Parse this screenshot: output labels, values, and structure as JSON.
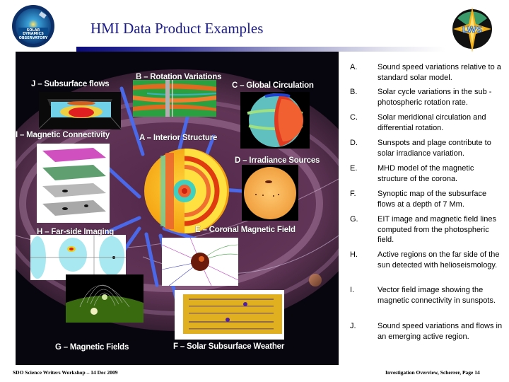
{
  "header": {
    "title": "HMI Data Product Examples",
    "logos": [
      {
        "name": "sdo-logo",
        "text": "SOLAR DYNAMICS OBSERVATORY"
      },
      {
        "name": "lws-logo",
        "text": "LWS"
      }
    ]
  },
  "figure": {
    "labels": {
      "J": "J – Subsurface flows",
      "B": "B – Rotation Variations",
      "C": "C – Global Circulation",
      "I": "I – Magnetic Connectivity",
      "A": "A – Interior Structure",
      "D": "D – Irradiance Sources",
      "H": "H – Far-side Imaging",
      "E": "E  – Coronal Magnetic Field",
      "G": "G  – Magnetic Fields",
      "F": "F – Solar Subsurface Weather"
    }
  },
  "descriptions": [
    {
      "letter": "A.",
      "text": "Sound speed variations relative to a standard solar model."
    },
    {
      "letter": "B.",
      "text": "Solar cycle variations in the sub -photospheric rotation rate."
    },
    {
      "letter": "C.",
      "text": "Solar meridional circulation and differential rotation."
    },
    {
      "letter": "D.",
      "text": "Sunspots and plage contribute to solar irradiance variation."
    },
    {
      "letter": "E.",
      "text": "MHD model of the magnetic structure of the corona."
    },
    {
      "letter": "F.",
      "text": "Synoptic map of the subsurface flows at a depth of 7 Mm."
    },
    {
      "letter": "G.",
      "text": "EIT image and magnetic field lines computed from the photospheric field."
    },
    {
      "letter": "H.",
      "text": "Active regions on the far side of the sun detected with helioseismology."
    },
    {
      "letter": "I.",
      "text": "Vector field image showing the magnetic connectivity in sunspots."
    },
    {
      "letter": "J.",
      "text": "Sound speed variations and flows in an emerging active region."
    }
  ],
  "footer": {
    "left": "SDO Science Writers Workshop – 14 Dec 2009",
    "right": "Investigation Overview, Scherrer, Page 14"
  }
}
